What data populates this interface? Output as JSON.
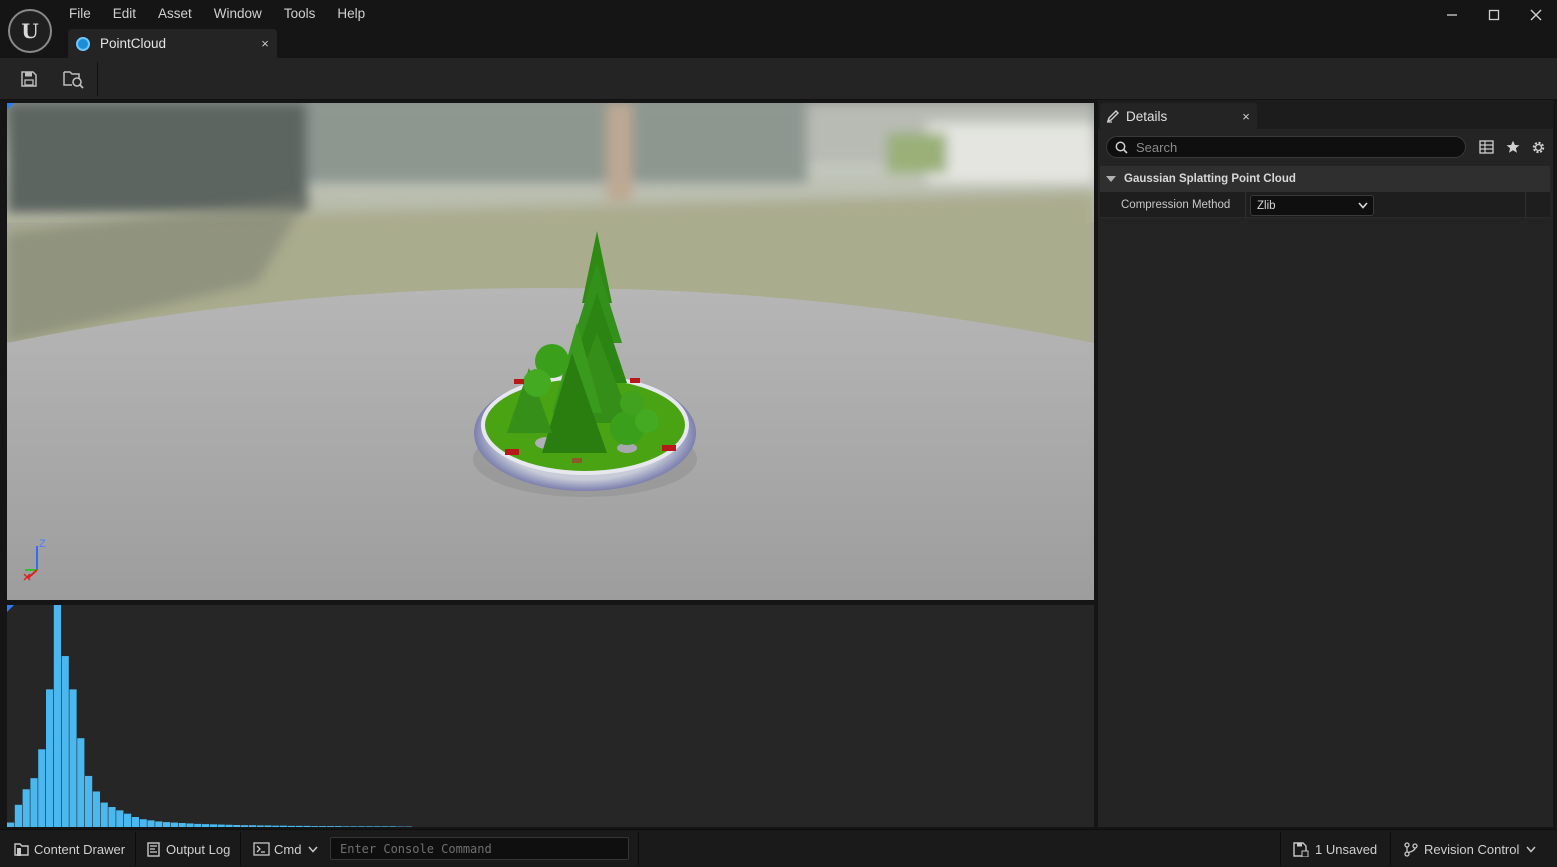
{
  "menu": {
    "items": [
      "File",
      "Edit",
      "Asset",
      "Window",
      "Tools",
      "Help"
    ]
  },
  "logo": {
    "label": "U"
  },
  "window_controls": {
    "minimize": "─",
    "maximize": "☐",
    "close": "✕"
  },
  "document_tab": {
    "label": "PointCloud",
    "close": "×"
  },
  "toolbar": {
    "save_icon": "save-icon",
    "browse_icon": "browse-to-asset-icon"
  },
  "viewport": {
    "axis": {
      "z_label": "Z"
    },
    "colors": {
      "sky": "#c9cdc4",
      "grass": "#a9ac8c",
      "floor": "#a5a5a5",
      "tree": "#3c9a1a",
      "pot": "#cfd3e0"
    }
  },
  "histogram": {
    "color": "#4ab8ef",
    "values": [
      2,
      10,
      17,
      22,
      35,
      62,
      100,
      77,
      62,
      40,
      23,
      16,
      11,
      9,
      7.5,
      6,
      4.5,
      3.5,
      3,
      2.5,
      2.2,
      2,
      1.8,
      1.6,
      1.4,
      1.3,
      1.2,
      1.1,
      1.0,
      0.9,
      0.8,
      0.8,
      0.7,
      0.7,
      0.6,
      0.6,
      0.5,
      0.5,
      0.5,
      0.4,
      0.4,
      0.4,
      0.4,
      0.3,
      0.3,
      0.3,
      0.3,
      0.3,
      0.3,
      0.3,
      0.2,
      0.2
    ]
  },
  "details": {
    "tab_label": "Details",
    "tab_close": "×",
    "search_placeholder": "Search",
    "category": "Gaussian Splatting Point Cloud",
    "properties": [
      {
        "name": "Compression Method",
        "value": "Zlib"
      }
    ]
  },
  "statusbar": {
    "content_drawer": "Content Drawer",
    "output_log": "Output Log",
    "cmd": "Cmd",
    "console_placeholder": "Enter Console Command",
    "unsaved": "1 Unsaved",
    "revision_control": "Revision Control"
  }
}
